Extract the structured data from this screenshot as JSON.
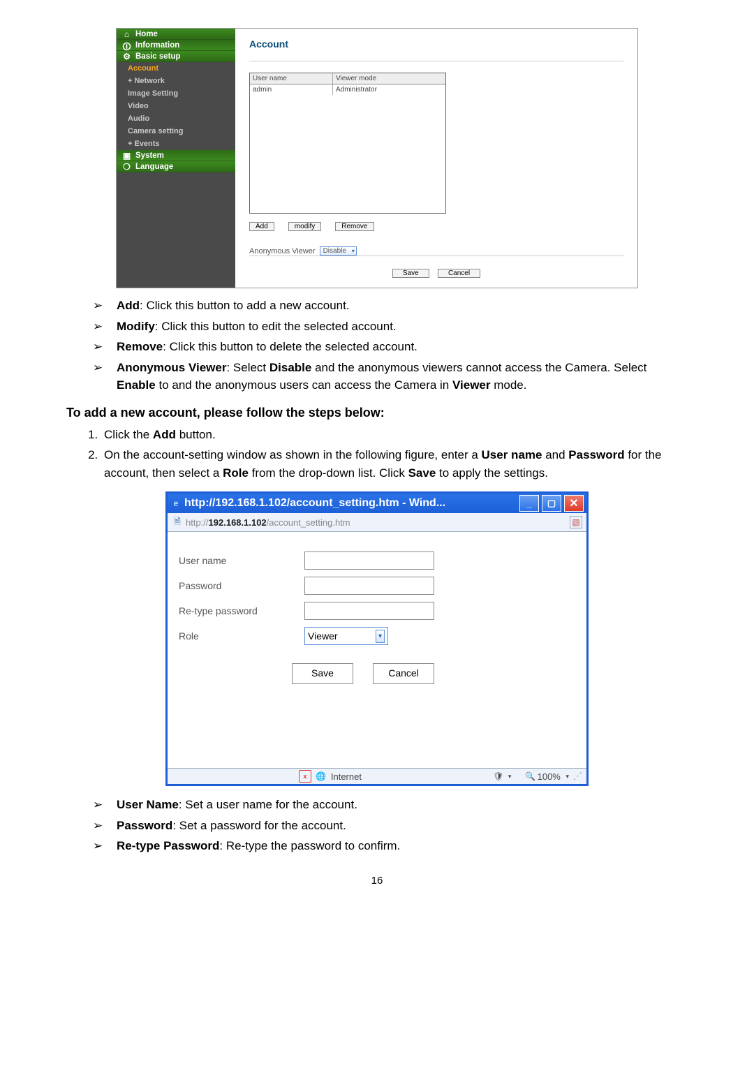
{
  "sidebar": {
    "home": "Home",
    "information": "Information",
    "basic": "Basic setup",
    "subs": {
      "account": "Account",
      "network": "+ Network",
      "image": "Image Setting",
      "video": "Video",
      "audio": "Audio",
      "camera": "Camera setting",
      "events": "+ Events"
    },
    "system": "System",
    "language": "Language"
  },
  "panel1": {
    "title": "Account",
    "col_user": "User name",
    "col_mode": "Viewer mode",
    "row_user": "admin",
    "row_mode": "Administrator",
    "btn_add": "Add",
    "btn_modify": "modify",
    "btn_remove": "Remove",
    "anon_label": "Anonymous Viewer",
    "anon_value": "Disable",
    "btn_save": "Save",
    "btn_cancel": "Cancel"
  },
  "list1": {
    "a": {
      "b": "Add",
      "t": ": Click this button to add a new account."
    },
    "b": {
      "b": "Modify",
      "t": ": Click this button to edit the selected account."
    },
    "c": {
      "b": "Remove",
      "t": ": Click this button to delete the selected account."
    },
    "d_pre": "Anonymous Viewer",
    "d_mid1": ": Select ",
    "d_b1": "Disable",
    "d_mid2": " and the anonymous viewers cannot access the Camera. Select ",
    "d_b2": "Enable",
    "d_mid3": " to and the anonymous users can access the Camera in ",
    "d_b3": "Viewer",
    "d_end": " mode."
  },
  "heading": "To add a new account, please follow the steps below:",
  "steps": {
    "s1_a": "Click the ",
    "s1_b": "Add",
    "s1_c": " button.",
    "s2_a": "On the account-setting window as shown in the following figure, enter a ",
    "s2_b": "User name",
    "s2_c": " and ",
    "s2_d": "Password",
    "s2_e": " for the account, then select a ",
    "s2_f": "Role",
    "s2_g": " from the drop-down list. Click ",
    "s2_h": "Save",
    "s2_i": " to apply the settings."
  },
  "dialog": {
    "title": "http://192.168.1.102/account_setting.htm - Wind...",
    "url_bold": "192.168.1.102",
    "url_pre": "http://",
    "url_post": "/account_setting.htm",
    "lbl_user": "User name",
    "lbl_pass": "Password",
    "lbl_repass": "Re-type password",
    "lbl_role": "Role",
    "role_value": "Viewer",
    "btn_save": "Save",
    "btn_cancel": "Cancel",
    "status_zone": "Internet",
    "status_zoom": "100%"
  },
  "list2": {
    "a": {
      "b": "User Name",
      "t": ": Set a user name for the account."
    },
    "b": {
      "b": "Password",
      "t": ": Set a password for the account."
    },
    "c": {
      "b": "Re-type Password",
      "t": ": Re-type the password to confirm."
    }
  },
  "page_number": "16"
}
